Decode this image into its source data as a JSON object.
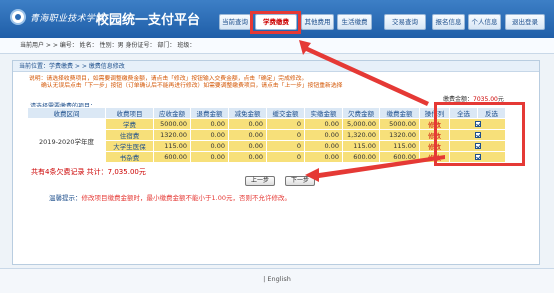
{
  "header": {
    "school_name": "青海职业技术学院",
    "app_title": "校园统一支付平台",
    "nav": [
      {
        "label": "当前查询"
      },
      {
        "label": "学费缴费"
      },
      {
        "label": "其他费用"
      },
      {
        "label": "生活缴费"
      },
      {
        "label": "交易查询"
      },
      {
        "label": "报名信息"
      },
      {
        "label": "个人信息"
      },
      {
        "label": "退出登录"
      }
    ],
    "active_index": 1
  },
  "userbar": {
    "text": "当前用户 > > 编号：                    姓名：            性别：男   身份证号：                              部门：                    班级："
  },
  "breadcrumb": "当前位置：学费缴费 > > 缴费信息修改",
  "description": {
    "line1": "说明：请选择收费项目，如需要调整缴费金额，请点击「修改」按钮输入交费金额，点击「确定」完成修改。",
    "line2": "确认无误后点击「下一步」按钮（订单确认后不能再进行修改）如需要调整缴费项目，请点击「上一步」按钮重新选择"
  },
  "total": {
    "label": "缴费金额：",
    "value": "7035.00",
    "unit": "元"
  },
  "select_label": "请选择需要缴费的项目：",
  "table": {
    "headers": [
      "收费区间",
      "收费项目",
      "应收金额",
      "退费金额",
      "减免金额",
      "缓交金额",
      "实缴金额",
      "欠费金额",
      "缴费金额",
      "操作列",
      "全选",
      "反选"
    ],
    "period": "2019-2020学年度",
    "rows": [
      {
        "item": "学费",
        "receivable": "5000.00",
        "refund": "0.00",
        "reduction": "0.00",
        "deferred": "0",
        "paid": "0.00",
        "owed": "5,000.00",
        "payment": "5000.00",
        "op": "修改"
      },
      {
        "item": "住宿费",
        "receivable": "1320.00",
        "refund": "0.00",
        "reduction": "0.00",
        "deferred": "0",
        "paid": "0.00",
        "owed": "1,320.00",
        "payment": "1320.00",
        "op": "修改"
      },
      {
        "item": "大学生医保",
        "receivable": "115.00",
        "refund": "0.00",
        "reduction": "0.00",
        "deferred": "0",
        "paid": "0.00",
        "owed": "115.00",
        "payment": "115.00",
        "op": "修改"
      },
      {
        "item": "书杂费",
        "receivable": "600.00",
        "refund": "0.00",
        "reduction": "0.00",
        "deferred": "0",
        "paid": "0.00",
        "owed": "600.00",
        "payment": "600.00",
        "op": "修改"
      }
    ]
  },
  "summary": "共有4条欠费记录  共计：7,035.00元",
  "buttons": {
    "prev": "上一步",
    "next": "下一步"
  },
  "tip": {
    "label": "温馨提示：",
    "text": "修改项目缴费金额时，最小缴费金额不能小于1.00元，否则不允许修改。"
  },
  "footer": "|  English",
  "colors": {
    "header_blue": "#2a6ab5",
    "highlight_red": "#e53935",
    "row_yellow": "#f7e07a"
  }
}
